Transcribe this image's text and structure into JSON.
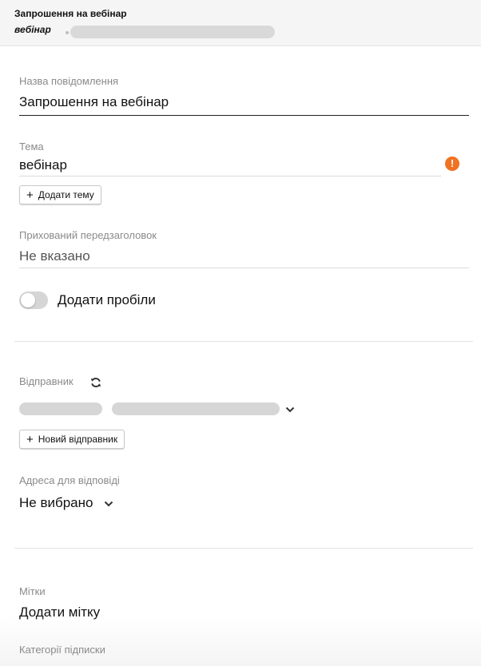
{
  "header": {
    "title": "Запрошення на вебінар",
    "subtitle": "вебінар"
  },
  "message_name": {
    "label": "Назва повідомлення",
    "value": "Запрошення на вебінар"
  },
  "subject": {
    "label": "Тема",
    "value": "вебінар",
    "warning_icon": "exclamation-circle-icon",
    "warning_color": "#f07222",
    "add_button": "Додати тему"
  },
  "preheader": {
    "label": "Прихований передзаголовок",
    "value": "Не вказано"
  },
  "spaces_toggle": {
    "label": "Додати пробіли",
    "enabled": false
  },
  "sender": {
    "label": "Відправник",
    "refresh_icon": "refresh-icon",
    "new_button": "Новий відправник"
  },
  "reply_to": {
    "label": "Адреса для відповіді",
    "value": "Не вибрано"
  },
  "tags": {
    "label": "Мітки",
    "value": "Додати мітку"
  },
  "subscription_categories": {
    "label": "Категорії підписки"
  }
}
